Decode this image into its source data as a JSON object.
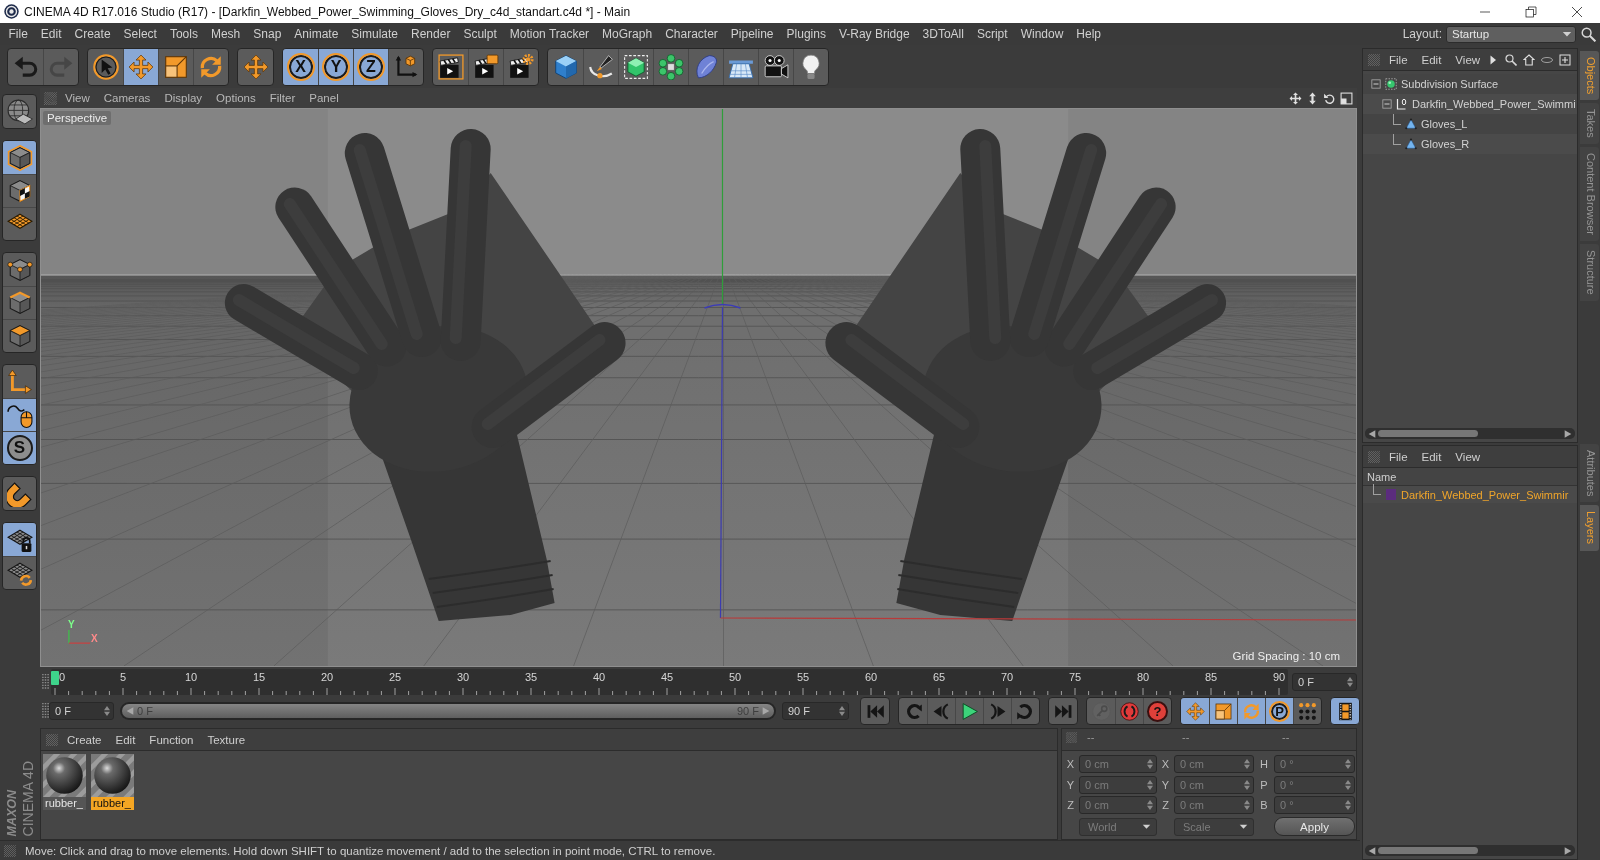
{
  "window": {
    "title": "CINEMA 4D R17.016 Studio (R17) - [Darkfin_Webbed_Power_Swimming_Gloves_Dry_c4d_standart.c4d *] - Main"
  },
  "menu_bar": {
    "items": [
      "File",
      "Edit",
      "Create",
      "Select",
      "Tools",
      "Mesh",
      "Snap",
      "Animate",
      "Simulate",
      "Render",
      "Sculpt",
      "Motion Tracker",
      "MoGraph",
      "Character",
      "Pipeline",
      "Plugins",
      "V-Ray Bridge",
      "3DToAll",
      "Script",
      "Window",
      "Help"
    ],
    "layout_label": "Layout:",
    "layout_value": "Startup"
  },
  "toolbar": [
    [
      {
        "kind": "undo",
        "disabled": false
      },
      {
        "kind": "redo",
        "disabled": true
      }
    ],
    [
      {
        "kind": "live-select",
        "selected": false
      },
      {
        "kind": "move",
        "selected": true
      },
      {
        "kind": "scale",
        "selected": false
      },
      {
        "kind": "rotate",
        "selected": false
      }
    ],
    [
      {
        "kind": "move-tool",
        "selected": false
      }
    ],
    [
      {
        "kind": "axis-lock",
        "label": "X",
        "selected": true
      },
      {
        "kind": "axis-lock",
        "label": "Y",
        "selected": true
      },
      {
        "kind": "axis-lock",
        "label": "Z",
        "selected": true
      },
      {
        "kind": "coord-system",
        "selected": false
      }
    ],
    [
      {
        "kind": "render-view"
      },
      {
        "kind": "render-picture"
      },
      {
        "kind": "render-settings"
      }
    ],
    [
      {
        "kind": "cube"
      },
      {
        "kind": "pen"
      },
      {
        "kind": "subdivision"
      },
      {
        "kind": "cloner"
      },
      {
        "kind": "deformer"
      },
      {
        "kind": "floor"
      },
      {
        "kind": "camera"
      },
      {
        "kind": "light"
      }
    ]
  ],
  "left_toolbar": [
    [
      {
        "kind": "make-editable"
      }
    ],
    [
      {
        "kind": "model-mode",
        "selected": true
      },
      {
        "kind": "texture-mode",
        "selected": false
      },
      {
        "kind": "workplane-mode",
        "selected": false
      }
    ],
    [
      {
        "kind": "points-mode",
        "selected": false
      },
      {
        "kind": "edges-mode",
        "selected": false
      },
      {
        "kind": "polygons-mode",
        "selected": false
      }
    ],
    [
      {
        "kind": "axis-mode",
        "selected": false
      },
      {
        "kind": "tweak-mode",
        "selected": true
      },
      {
        "kind": "snap",
        "label": "S",
        "selected": true
      }
    ],
    [
      {
        "kind": "magnet",
        "selected": false
      }
    ],
    [
      {
        "kind": "lock-workplane",
        "selected": true
      },
      {
        "kind": "align-workplane",
        "selected": false
      }
    ]
  ],
  "viewport": {
    "menu": [
      "View",
      "Cameras",
      "Display",
      "Options",
      "Filter",
      "Panel"
    ],
    "camera": "Perspective",
    "grid_spacing": "Grid Spacing : 10 cm",
    "axis_labels": [
      "Y",
      "X"
    ]
  },
  "timeline": {
    "frames": [
      "0",
      "5",
      "10",
      "15",
      "20",
      "25",
      "30",
      "35",
      "40",
      "45",
      "50",
      "55",
      "60",
      "65",
      "70",
      "75",
      "80",
      "85",
      "90"
    ],
    "playhead": {
      "level": 0
    },
    "current_field": "0 F"
  },
  "range": {
    "start_field": "0 F",
    "slider_start": "0 F",
    "slider_end": "90 F",
    "end_field": "90 F",
    "level": 1
  },
  "transport": [
    [
      {
        "kind": "go-start"
      }
    ],
    [
      {
        "kind": "prev-key"
      },
      {
        "kind": "step-back"
      },
      {
        "kind": "play"
      },
      {
        "kind": "step-forward"
      },
      {
        "kind": "next-key"
      }
    ],
    [
      {
        "kind": "go-end"
      }
    ],
    [
      {
        "kind": "key",
        "disabled": true
      },
      {
        "kind": "record",
        "disabled": false
      },
      {
        "kind": "autokey",
        "label": "?",
        "disabled": false
      }
    ],
    [
      {
        "kind": "key-move",
        "selected": true
      },
      {
        "kind": "key-scale",
        "selected": true
      },
      {
        "kind": "key-rotate",
        "selected": true
      },
      {
        "kind": "key-param",
        "label": "P",
        "selected": true
      },
      {
        "kind": "key-points",
        "selected": false
      }
    ],
    [
      {
        "kind": "timeline-film",
        "selected": true
      }
    ]
  ],
  "material_manager": {
    "menu": [
      "Create",
      "Edit",
      "Function",
      "Texture"
    ],
    "materials": [
      {
        "name": "rubber_",
        "selected": false
      },
      {
        "name": "rubber_",
        "selected": true
      }
    ]
  },
  "coordinates": {
    "headers": [
      "--",
      "--",
      "--"
    ],
    "disabled": true,
    "rows": [
      [
        {
          "axis": "X",
          "value": "0 cm"
        },
        {
          "axis": "X",
          "value": "0 cm"
        },
        {
          "axis": "H",
          "value": "0 °"
        }
      ],
      [
        {
          "axis": "Y",
          "value": "0 cm"
        },
        {
          "axis": "Y",
          "value": "0 cm"
        },
        {
          "axis": "P",
          "value": "0 °"
        }
      ],
      [
        {
          "axis": "Z",
          "value": "0 cm"
        },
        {
          "axis": "Z",
          "value": "0 cm"
        },
        {
          "axis": "B",
          "value": "0 °"
        }
      ]
    ],
    "dropdowns": [
      "World",
      "Scale"
    ],
    "apply": "Apply"
  },
  "brand": {
    "maxon": "MAXON",
    "product": "CINEMA 4D"
  },
  "status_bar": {
    "message": "Move: Click and drag to move elements. Hold down SHIFT to quantize movement / add to the selection in point mode, CTRL to remove."
  },
  "object_manager": {
    "menu": [
      "File",
      "Edit",
      "View"
    ],
    "objects": [
      {
        "name": "Subdivision Surface",
        "kind": "subdivision-surface",
        "expanded": true,
        "children": [
          {
            "name": "Darkfin_Webbed_Power_Swimmi",
            "kind": "null",
            "expanded": true,
            "children": [
              {
                "name": "Gloves_L",
                "kind": "polygon"
              },
              {
                "name": "Gloves_R",
                "kind": "polygon"
              }
            ]
          }
        ]
      }
    ]
  },
  "side_tabs_top": [
    {
      "label": "Objects",
      "selected": true
    },
    {
      "label": "Takes",
      "selected": false
    },
    {
      "label": "Content Browser",
      "selected": false
    },
    {
      "label": "Structure",
      "selected": false
    }
  ],
  "layer_manager": {
    "menu": [
      "File",
      "Edit",
      "View"
    ],
    "column": "Name",
    "layers": [
      {
        "name": "Darkfin_Webbed_Power_Swimmir",
        "color": "#5b2c7e",
        "selected": true
      }
    ]
  },
  "side_tabs_bottom": [
    {
      "label": "Attributes",
      "selected": false
    },
    {
      "label": "Layers",
      "selected": true
    }
  ]
}
